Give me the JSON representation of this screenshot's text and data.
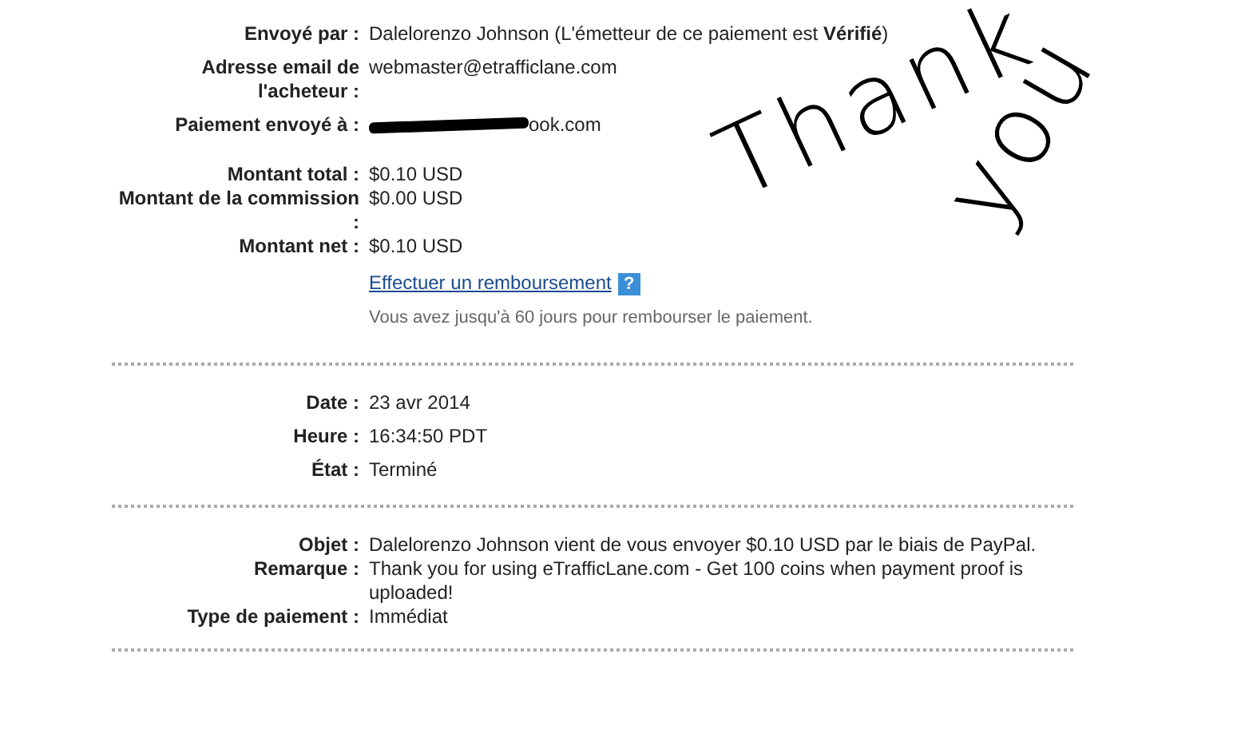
{
  "sections": [
    {
      "groups": [
        [
          {
            "label": "Envoyé par :",
            "value": "Dalelorenzo Johnson (L'émetteur de ce paiement est **Vérifié**)",
            "kind": "text"
          },
          {
            "label": "Adresse email de l'acheteur :",
            "value": "webmaster@etrafficlane.com",
            "kind": "text"
          },
          {
            "label": "Paiement envoyé à :",
            "value": "ook.com",
            "kind": "redacted"
          }
        ],
        [
          {
            "label": "Montant total :",
            "value": "$0.10 USD",
            "kind": "text"
          },
          {
            "label": "Montant de la commission :",
            "value": "$0.00 USD",
            "kind": "text"
          },
          {
            "label": "Montant net :",
            "value": "$0.10 USD",
            "kind": "text"
          }
        ]
      ],
      "refund": {
        "link": "Effectuer un remboursement",
        "help": "?",
        "note": "Vous avez jusqu'à 60 jours pour rembourser le paiement."
      }
    },
    {
      "groups": [
        [
          {
            "label": "Date :",
            "value": "23 avr 2014",
            "kind": "text"
          },
          {
            "label": "Heure :",
            "value": "16:34:50 PDT",
            "kind": "text"
          },
          {
            "label": "État :",
            "value": "Terminé",
            "kind": "text"
          }
        ]
      ]
    },
    {
      "groups": [
        [
          {
            "label": "Objet :",
            "value": "Dalelorenzo Johnson vient de vous envoyer $0.10 USD par le biais de PayPal.",
            "kind": "text"
          },
          {
            "label": "Remarque :",
            "value": "Thank you for using eTrafficLane.com - Get 100 coins when payment proof is uploaded!",
            "kind": "text"
          },
          {
            "label": "Type de paiement :",
            "value": "Immédiat",
            "kind": "text"
          }
        ]
      ]
    }
  ],
  "handwriting": [
    "Thank",
    "you"
  ]
}
